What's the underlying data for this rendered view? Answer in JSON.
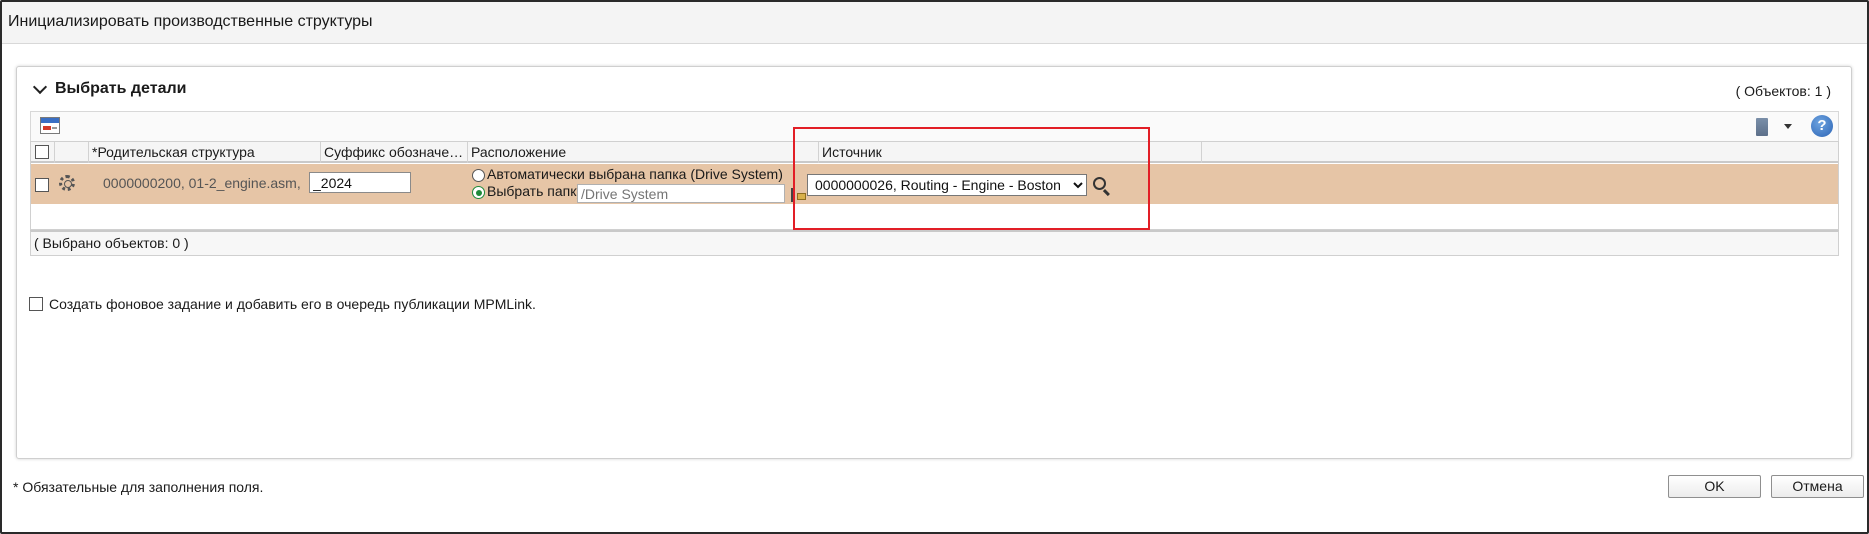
{
  "window": {
    "title": "Инициализировать производственные структуры"
  },
  "panel": {
    "title": "Выбрать детали",
    "object_count": "( Объектов: 1 )"
  },
  "toolbar": {
    "left_icon": "table-view-icon",
    "calc_icon": "calculator-icon",
    "help_icon": "help-icon",
    "help_glyph": "?"
  },
  "table": {
    "columns": [
      "*Родительская структура",
      "Суффикс обозначе…",
      "Расположение",
      "Источник"
    ],
    "row": {
      "parent": "0000000200, 01-2_engine.asm,",
      "suffix": "_2024",
      "location_auto_label": "Автоматически выбрана папка (Drive System)",
      "location_choose_label": "Выбрать папку",
      "folder_placeholder": "/Drive System",
      "source_selected": "0000000026, Routing - Engine - Boston"
    },
    "selected_count": "( Выбрано объектов: 0 )"
  },
  "background_job_label": "Создать фоновое задание и добавить его в очередь публикации MPMLink.",
  "footer": {
    "required_note": "* Обязательные для заполнения поля.",
    "ok_label": "OK",
    "cancel_label": "Отмена"
  },
  "colors": {
    "row_selected_bg": "#e6c5a6",
    "highlight_border": "#e21e26",
    "radio_active": "#1e8a3a"
  }
}
